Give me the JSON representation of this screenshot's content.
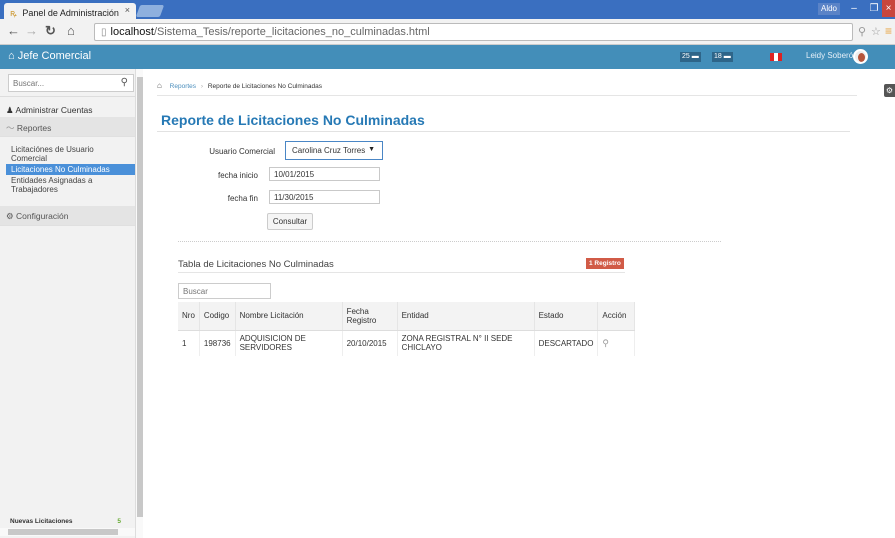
{
  "browser": {
    "tab_title": "Panel de Administración",
    "tab_close": "×",
    "user_label": "Aldo",
    "url_host": "localhost",
    "url_path": "/Sistema_Tesis/reporte_licitaciones_no_culminadas.html",
    "icons": [
      "back-arrow-icon",
      "forward-arrow-icon",
      "reload-icon",
      "home-icon",
      "page-icon",
      "search-icon",
      "star-icon",
      "menu-icon"
    ]
  },
  "navbar": {
    "brand": "Jefe Comercial",
    "mail_count": "25",
    "notif_count": "18",
    "user_name": "Leidy Soberón"
  },
  "sidebar": {
    "search_placeholder": "Buscar...",
    "items": [
      {
        "label": "Administrar Cuentas"
      },
      {
        "label": "Reportes"
      },
      {
        "label": "Configuración"
      }
    ],
    "sub_items": [
      {
        "label": "Licitaciónes de Usuario Comercial"
      },
      {
        "label": "Licitaciones No Culminadas"
      },
      {
        "label": "Entidades Asignadas a Trabajadores"
      }
    ],
    "bottom_label": "Nuevas Licitaciones",
    "bottom_count": "5"
  },
  "breadcrumb": {
    "parent": "Reportes",
    "current": "Reporte de Licitaciones No Culminadas"
  },
  "page": {
    "title": "Reporte de Licitaciones No Culminadas"
  },
  "form": {
    "usuario_label": "Usuario Comercial",
    "usuario_value": "Carolina Cruz Torres",
    "fecha_inicio_label": "fecha inicio",
    "fecha_inicio_value": "10/01/2015",
    "fecha_fin_label": "fecha fin",
    "fecha_fin_value": "11/30/2015",
    "submit_label": "Consultar"
  },
  "table": {
    "title": "Tabla de Licitaciones No Culminadas",
    "count_badge": "1 Registro",
    "search_placeholder": "Buscar",
    "columns": [
      "Nro",
      "Codigo",
      "Nombre Licitación",
      "Fecha Registro",
      "Entidad",
      "Estado",
      "Acción"
    ],
    "rows": [
      {
        "nro": "1",
        "codigo": "198736",
        "nombre": "ADQUISICION DE SERVIDORES",
        "fecha": "20/10/2015",
        "entidad": "ZONA REGISTRAL N° II SEDE CHICLAYO",
        "estado": "DESCARTADO"
      }
    ]
  }
}
